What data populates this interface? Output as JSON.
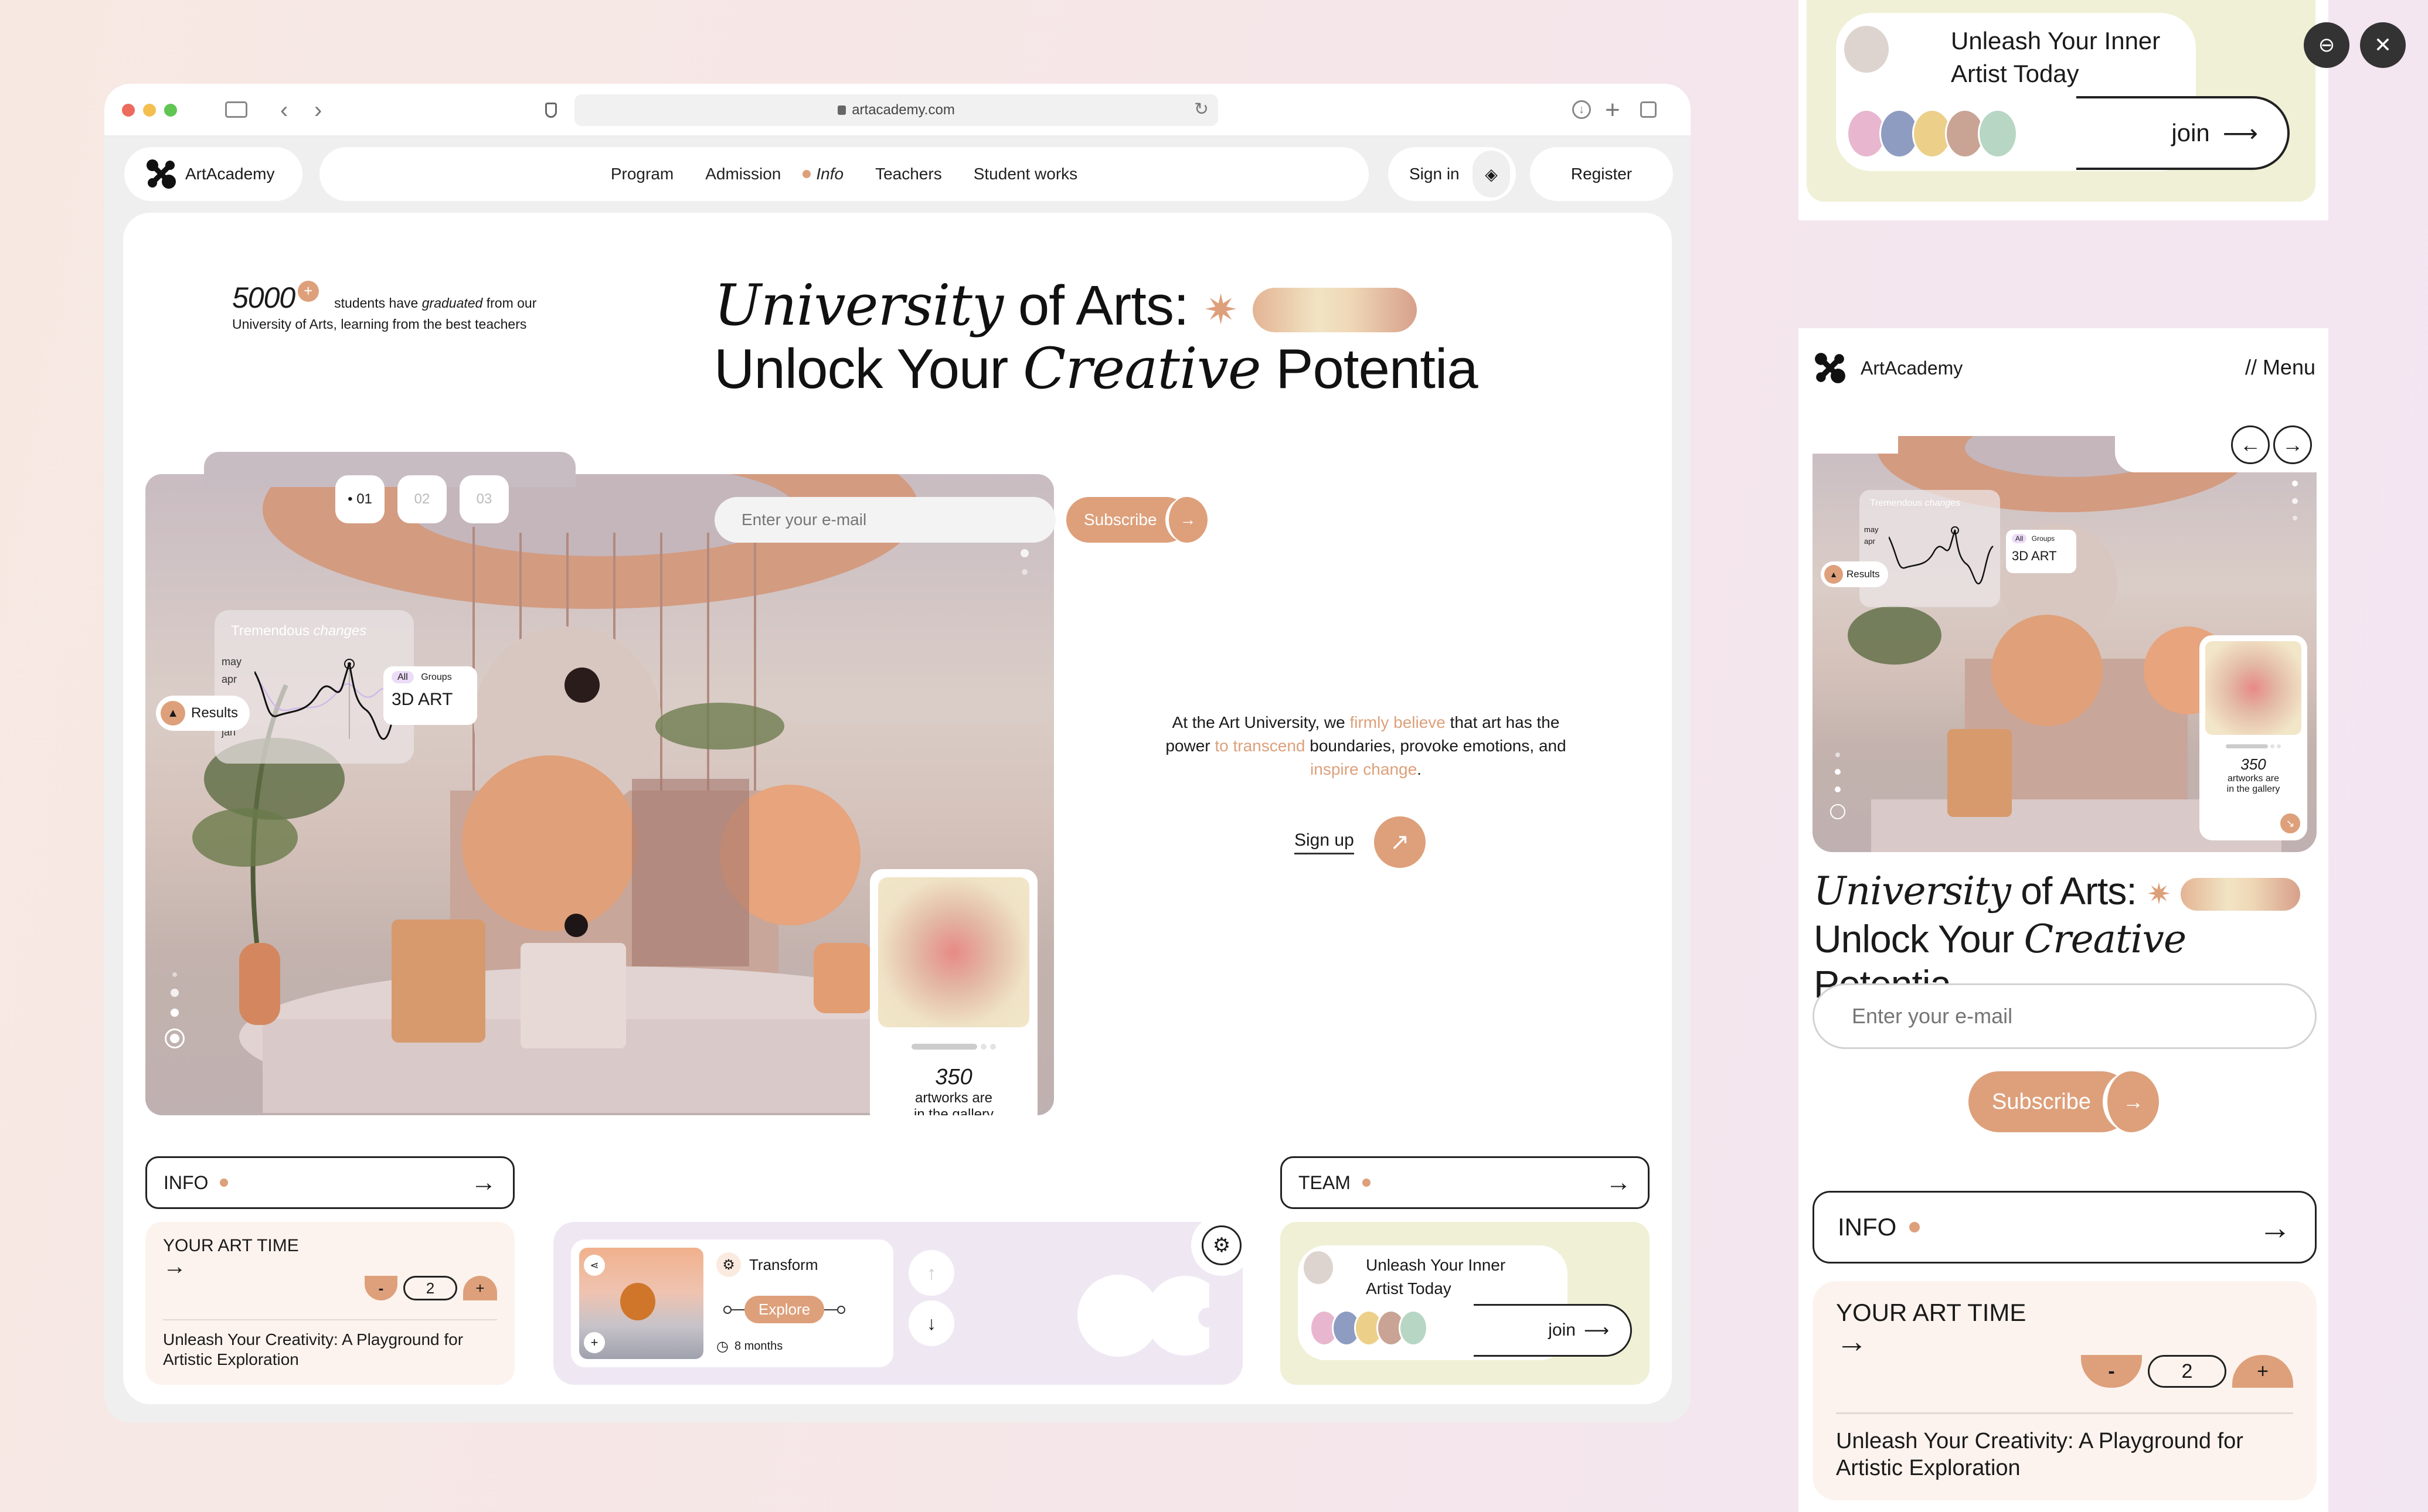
{
  "browser": {
    "url": "artacademy.com",
    "traffic_lights": [
      "#ec6a5e",
      "#f4bf4f",
      "#61c554"
    ],
    "icons": [
      "sidebar-icon",
      "back-icon",
      "forward-icon",
      "shield-icon",
      "lock-icon",
      "reload-icon",
      "download-icon",
      "new-tab-icon",
      "tabs-icon"
    ]
  },
  "brand": {
    "name": "ArtAcademy",
    "accent": "#dda07b",
    "logo_icon": "four-dot-x-logo"
  },
  "nav": {
    "items": [
      {
        "label": "Program",
        "active": false
      },
      {
        "label": "Admission",
        "active": false
      },
      {
        "label": "Info",
        "active": true
      },
      {
        "label": "Teachers",
        "active": false
      },
      {
        "label": "Student works",
        "active": false
      }
    ],
    "sign_in": "Sign in",
    "register": "Register"
  },
  "stats": {
    "count": "5000",
    "plus": "+",
    "text_before": "students have ",
    "text_italic": "graduated",
    "text_after": " from our University of Arts, learning from the best teachers"
  },
  "slides": {
    "tabs": [
      "01",
      "02",
      "03"
    ],
    "active": "01"
  },
  "hero": {
    "line1_italic": "University",
    "line1_rest": " of Arts:",
    "star": "✷",
    "line2_a": "Unlock Your ",
    "line2_italic": "Creative",
    "line2_b": " Potentia",
    "email_placeholder": "Enter your e-mail",
    "subscribe": "Subscribe",
    "subscribe_arrow": "→"
  },
  "chart_widget": {
    "title": "Tremendous ",
    "title_italic": "changes",
    "y_labels": [
      "may",
      "apr",
      "jan"
    ],
    "results_label": "Results",
    "filter_all": "All",
    "filter_groups": "Groups",
    "category": "3D ART"
  },
  "gallery_card": {
    "count": "350",
    "line1": "artworks are",
    "line2": "in the gallery"
  },
  "mission": {
    "parts": [
      {
        "t": "At the Art University, we ",
        "accent": false
      },
      {
        "t": "firmly believe",
        "accent": true
      },
      {
        "t": " that art has the power ",
        "accent": false
      },
      {
        "t": "to transcend",
        "accent": true
      },
      {
        "t": " boundaries, provoke emotions, and ",
        "accent": false
      },
      {
        "t": "inspire change",
        "accent": true
      },
      {
        "t": ".",
        "accent": false
      }
    ],
    "signup": "Sign up"
  },
  "info_bar": {
    "label": "INFO",
    "arrow": "→"
  },
  "team_bar": {
    "label": "TEAM",
    "arrow": "→"
  },
  "art_time": {
    "title": "YOUR ART TIME",
    "arrow": "→",
    "minus": "-",
    "value": "2",
    "plus": "+",
    "desc": "Unleash Your Creativity: A Playground for Artistic Exploration"
  },
  "transform": {
    "label": "Transform",
    "explore": "Explore",
    "duration": "8 months"
  },
  "join_card": {
    "title": "Unleash Your Inner Artist Today",
    "join": "join",
    "avatar_count": 5
  },
  "mobile": {
    "menu": "// Menu"
  },
  "overlay": {
    "zoom_out_icon": "zoom-out-icon",
    "close_icon": "close-icon"
  }
}
